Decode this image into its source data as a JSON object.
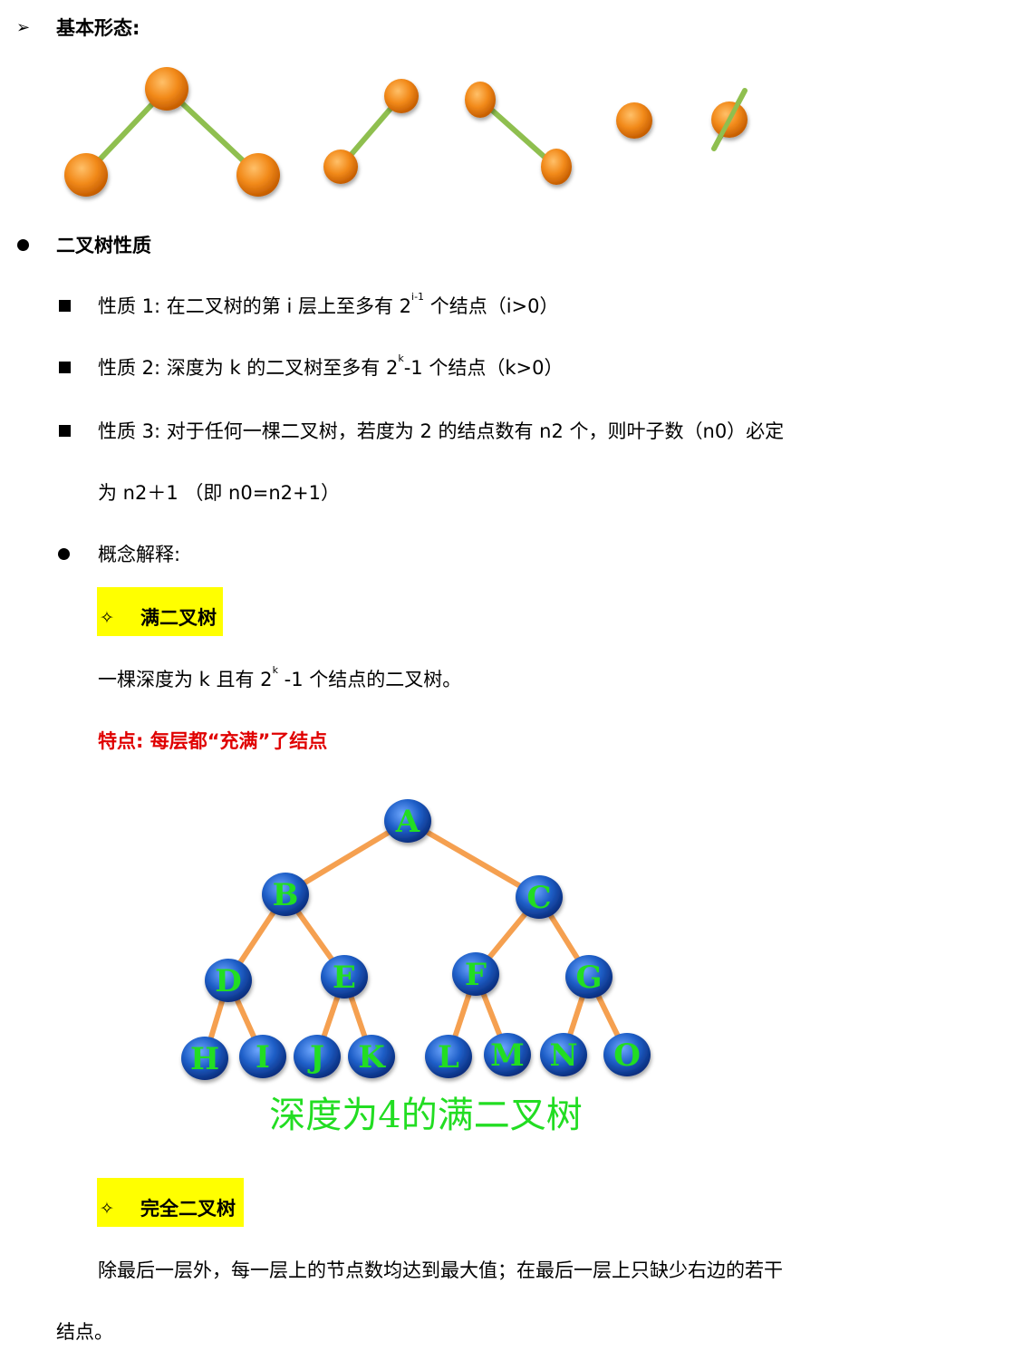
{
  "heading1": {
    "bullet": "➢",
    "text": "基本形态:"
  },
  "heading2": {
    "text": "二叉树性质"
  },
  "property1": {
    "a": "性质 1:  在二叉树的第 i 层上至多有 2",
    "sup": "i-1",
    "b": " 个结点（i>0）"
  },
  "property2": {
    "a": "性质 2:  深度为 k 的二叉树至多有 2",
    "sup": "k",
    "b": "-1 个结点（k>0）"
  },
  "property3": {
    "line1": "性质 3:  对于任何一棵二叉树，若度为 2 的结点数有 n2 个，则叶子数（n0）必定",
    "line2": "为 n2＋1  （即 n0=n2+1）"
  },
  "concept": {
    "text": "概念解释:"
  },
  "full_tree": {
    "bullet": "✧",
    "title": "满二叉树",
    "def_a": "一棵深度为 k  且有 2",
    "def_sup": "k",
    "def_b": " -1 个结点的二叉树。",
    "feature": "特点:  每层都“充满”了结点",
    "figure_caption": "深度为4的满二叉树",
    "nodes": [
      "A",
      "B",
      "C",
      "D",
      "E",
      "F",
      "G",
      "H",
      "I",
      "J",
      "K",
      "L",
      "M",
      "N",
      "O"
    ]
  },
  "complete_tree": {
    "bullet": "✧",
    "title": "完全二叉树",
    "line1": "除最后一层外，每一层上的节点数均达到最大值；在最后一层上只缺少右边的若干",
    "line2": "结点。"
  },
  "colors": {
    "orange_node": "#f28a1a",
    "green_edge": "#8fbf4f",
    "blue_node": "#1f5fc8",
    "green_label": "#22dd22",
    "orange_edge": "#f5a050",
    "highlight": "#ffff00",
    "red_text": "#e00000"
  }
}
